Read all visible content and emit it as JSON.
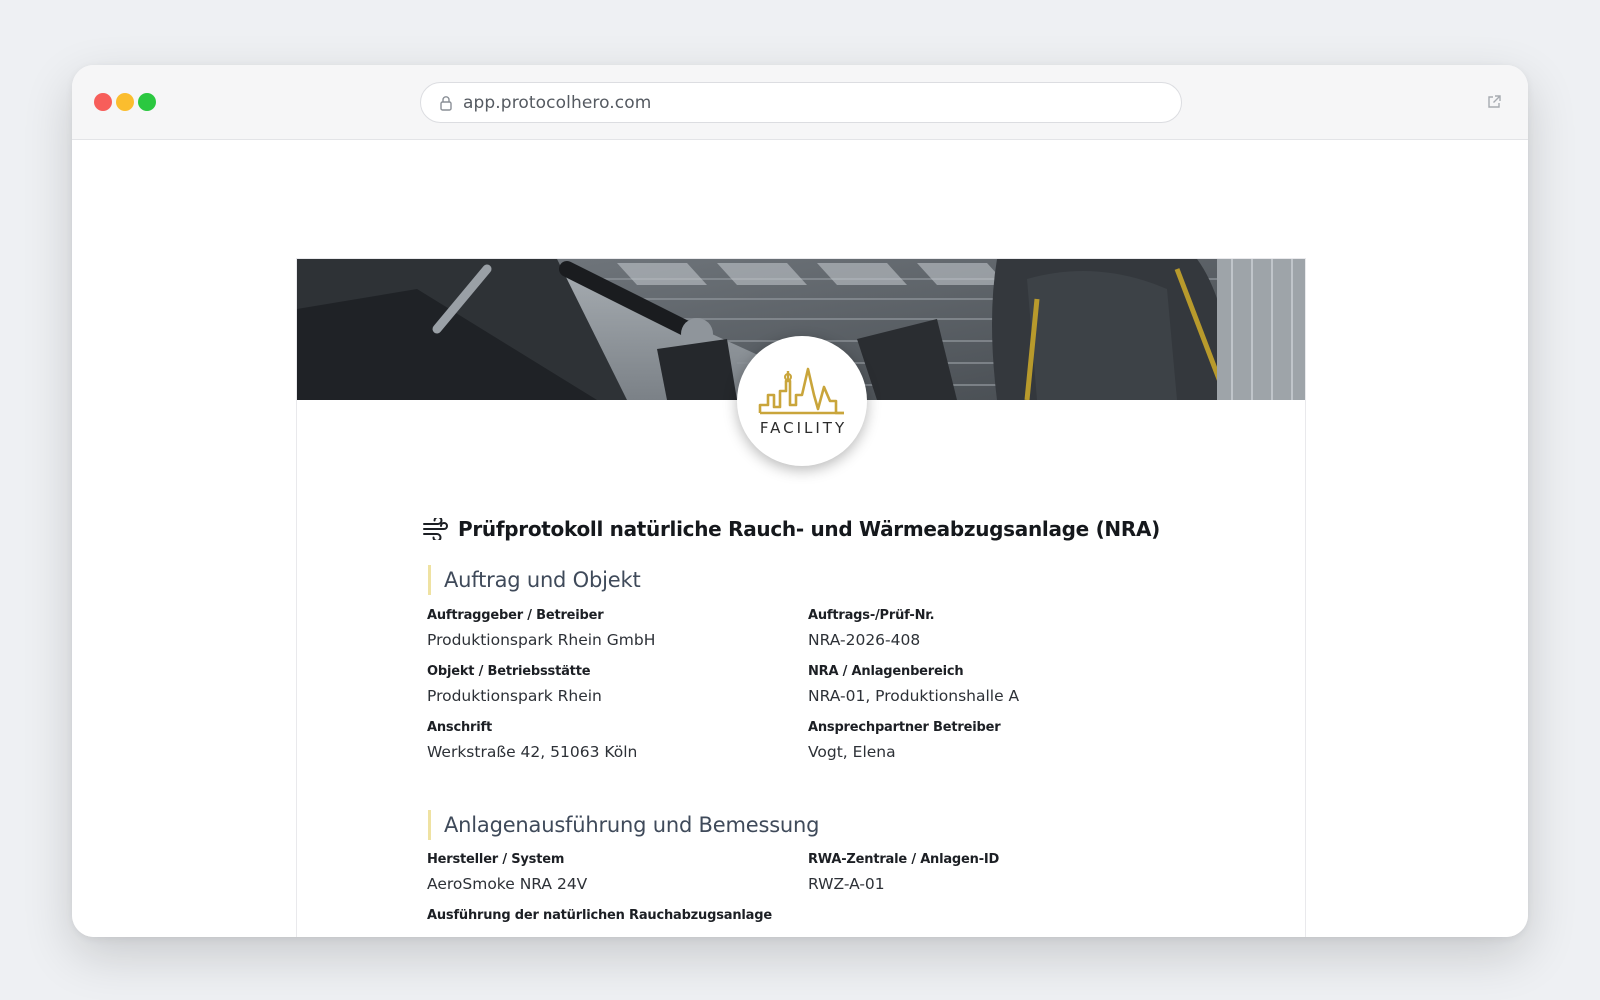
{
  "browser": {
    "url": "app.protocolhero.com"
  },
  "logo": {
    "text": "FACILITY",
    "accent_color": "#c9a53b"
  },
  "document": {
    "title": "Prüfprotokoll natürliche Rauch- und Wärmeabzugsanlage (NRA)",
    "title_icon": "wind-icon"
  },
  "sections": [
    {
      "heading": "Auftrag und Objekt",
      "fields": [
        {
          "label": "Auftraggeber / Betreiber",
          "value": "Produktionspark Rhein GmbH"
        },
        {
          "label": "Auftrags-/Prüf-Nr.",
          "value": "NRA-2026-408"
        },
        {
          "label": "Objekt / Betriebsstätte",
          "value": "Produktionspark Rhein"
        },
        {
          "label": "NRA / Anlagenbereich",
          "value": "NRA-01, Produktionshalle A"
        },
        {
          "label": "Anschrift",
          "value": "Werkstraße 42, 51063 Köln"
        },
        {
          "label": "Ansprechpartner Betreiber",
          "value": "Vogt, Elena"
        }
      ]
    },
    {
      "heading": "Anlagenausführung und Bemessung",
      "fields": [
        {
          "label": "Hersteller / System",
          "value": "AeroSmoke NRA 24V"
        },
        {
          "label": "RWA-Zentrale / Anlagen-ID",
          "value": "RWZ-A-01"
        },
        {
          "label": "Ausführung der natürlichen Rauchabzugsanlage",
          "value": ""
        }
      ]
    }
  ]
}
